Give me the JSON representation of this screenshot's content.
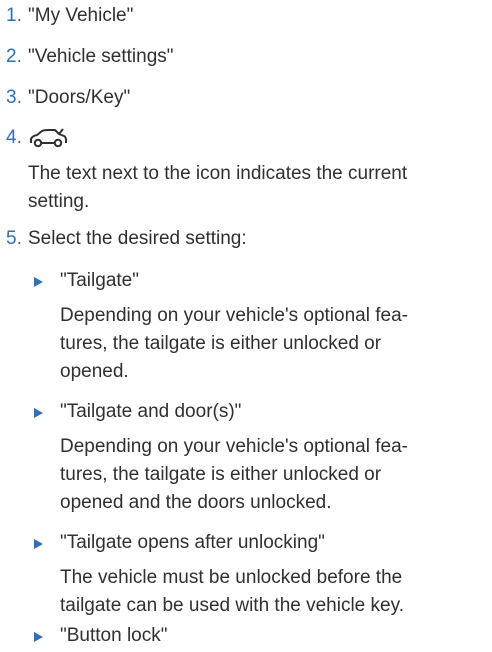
{
  "steps": [
    {
      "number": "1.",
      "text": "\"My Vehicle\""
    },
    {
      "number": "2.",
      "text": "\"Vehicle settings\""
    },
    {
      "number": "3.",
      "text": "\"Doors/Key\""
    },
    {
      "number": "4.",
      "icon": "car-tailgate-icon"
    },
    {
      "number": "5.",
      "text": "Select the desired setting:"
    }
  ],
  "step4_note": [
    "The text next to the icon indicates the current",
    "setting."
  ],
  "options": [
    {
      "label": "\"Tailgate\"",
      "description": [
        "Depending on your vehicle's optional fea-",
        "tures, the tailgate is either unlocked or",
        "opened."
      ]
    },
    {
      "label": "\"Tailgate and door(s)\"",
      "description": [
        "Depending on your vehicle's optional fea-",
        "tures, the tailgate is either unlocked or",
        "opened and the doors unlocked."
      ]
    },
    {
      "label": "\"Tailgate opens after unlocking\"",
      "description": [
        "The vehicle must be unlocked before the",
        "tailgate can be used with the vehicle key."
      ]
    },
    {
      "label": "\"Button lock\""
    }
  ],
  "colors": {
    "accent": "#2e6fb5",
    "text": "#303030"
  }
}
